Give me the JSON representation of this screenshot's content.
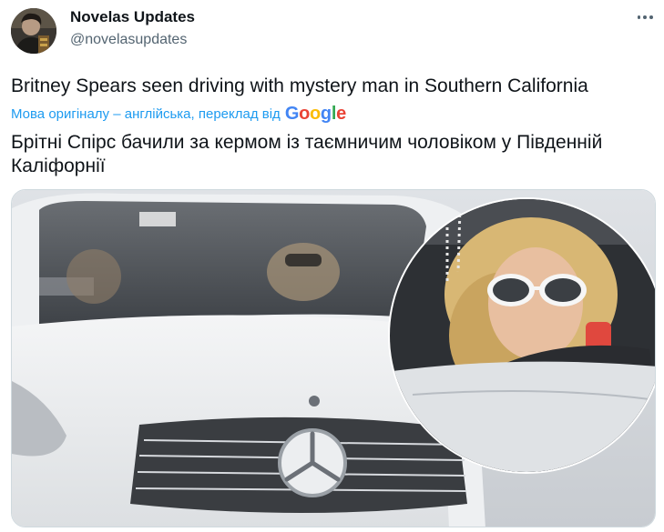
{
  "tweet": {
    "author": {
      "display_name": "Novelas Updates",
      "handle": "@novelasupdates",
      "avatar_icon": "profile-photo"
    },
    "more_icon": "more-horizontal-icon",
    "text": "Britney Spears seen driving with mystery man in Southern California",
    "translation_label": "Мова оригіналу – англійська, переклад від",
    "translation_provider": "Google",
    "translated_text": "Брітні Спірс бачили за кермом із таємничим чоловіком у Південній Каліфорнії",
    "media": {
      "type": "photo",
      "icon": "car-photo"
    }
  },
  "colors": {
    "link": "#1d9bf0",
    "text": "#0f1419",
    "secondary": "#536471",
    "border": "#cfd9de",
    "google_blue": "#4285F4",
    "google_red": "#EA4335",
    "google_yellow": "#FBBC05",
    "google_green": "#34A853"
  }
}
